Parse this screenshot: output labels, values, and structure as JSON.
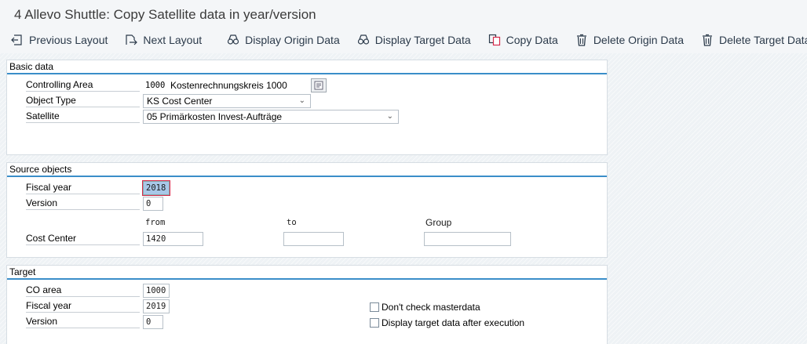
{
  "window": {
    "title": "4 Allevo Shuttle: Copy Satellite data in year/version"
  },
  "toolbar": {
    "previous_layout": "Previous Layout",
    "next_layout": "Next Layout",
    "display_origin": "Display Origin Data",
    "display_target": "Display Target Data",
    "copy_data": "Copy Data",
    "delete_origin": "Delete Origin Data",
    "delete_target": "Delete Target Data"
  },
  "basic_data": {
    "title": "Basic data",
    "controlling_area": {
      "label": "Controlling Area",
      "code": "1000",
      "text": "Kostenrechnungskreis 1000"
    },
    "object_type": {
      "label": "Object Type",
      "value": "KS Cost Center"
    },
    "satellite": {
      "label": "Satellite",
      "value": "05 Primärkosten Invest-Aufträge"
    }
  },
  "source_objects": {
    "title": "Source objects",
    "fiscal_year": {
      "label": "Fiscal year",
      "value": "2018"
    },
    "version": {
      "label": "Version",
      "value": "0"
    },
    "col_from": "from",
    "col_to": "to",
    "col_group": "Group",
    "cost_center": {
      "label": "Cost Center",
      "from": "1420",
      "to": "",
      "group": ""
    }
  },
  "target": {
    "title": "Target",
    "co_area": {
      "label": "CO area",
      "value": "1000"
    },
    "fiscal_year": {
      "label": "Fiscal year",
      "value": "2019"
    },
    "version": {
      "label": "Version",
      "value": "0"
    },
    "dont_check": {
      "label": "Don't check masterdata",
      "checked": false
    },
    "display_after": {
      "label": "Display target data after execution",
      "checked": false
    }
  },
  "colors": {
    "accent": "#3a8ec9",
    "focus": "#d62b4b",
    "selection": "#a8c8e8"
  }
}
